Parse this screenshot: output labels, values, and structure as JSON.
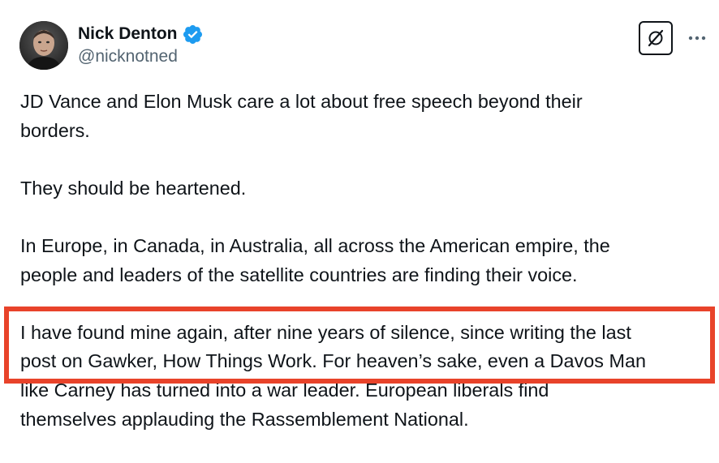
{
  "author": {
    "display_name": "Nick Denton",
    "handle": "@nicknotned",
    "verified": true,
    "avatar_icon": "avatar-photo"
  },
  "actions": {
    "grok_icon": "grok-icon",
    "more_icon": "more-horizontal-icon"
  },
  "colors": {
    "verified_badge": "#1d9bf0",
    "highlight_border": "#e8432a",
    "text_primary": "#0f1419",
    "text_secondary": "#536471"
  },
  "tweet": {
    "paragraphs": [
      {
        "lines": [
          "JD Vance and Elon Musk care a lot about free speech beyond their",
          "borders."
        ]
      },
      {
        "lines": [
          "They should be heartened."
        ]
      },
      {
        "lines": [
          "In Europe, in Canada, in Australia, all across the American empire, the",
          "people and leaders of the satellite countries are finding their voice."
        ]
      },
      {
        "lines": [
          "I have found mine again, after nine years of silence, since writing the last",
          "post on Gawker, How Things Work. For heaven’s sake, even a Davos Man",
          "like Carney has turned into a war leader. European liberals find",
          "themselves applauding the Rassemblement National."
        ]
      }
    ]
  }
}
